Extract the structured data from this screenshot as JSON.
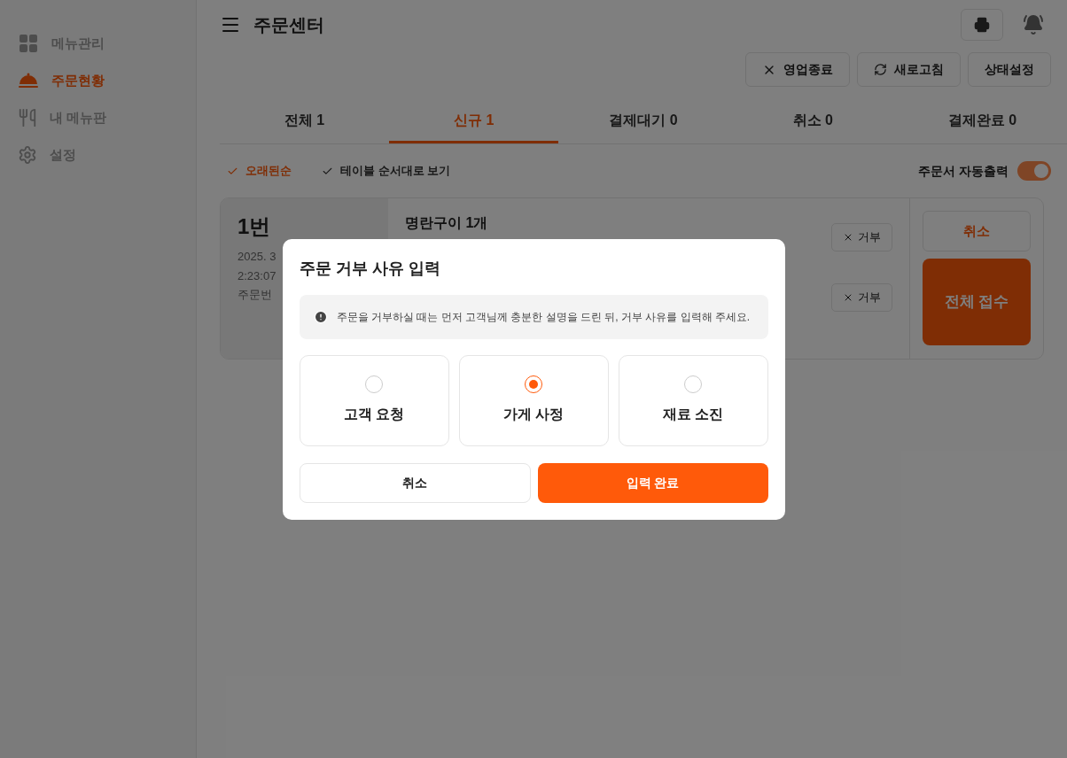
{
  "sidebar": {
    "items": [
      {
        "label": "메뉴관리",
        "selected": false
      },
      {
        "label": "주문현황",
        "selected": true
      },
      {
        "label": "내 메뉴판",
        "selected": false
      },
      {
        "label": "설정",
        "selected": false
      }
    ]
  },
  "header": {
    "title": "주문센터"
  },
  "action_buttons": [
    {
      "label": "영업종료"
    },
    {
      "label": "새로고침"
    },
    {
      "label": "상태설정"
    }
  ],
  "tabs": [
    {
      "label": "전체 1",
      "selected": false
    },
    {
      "label": "신규 1",
      "selected": true
    },
    {
      "label": "결제대기 0",
      "selected": false
    },
    {
      "label": "취소 0",
      "selected": false
    },
    {
      "label": "결제완료 0",
      "selected": false
    }
  ],
  "sort_options": [
    {
      "label": "오래된순",
      "selected": true
    },
    {
      "label": "테이블 순서대로 보기",
      "selected": false
    }
  ],
  "auto_print": {
    "label": "주문서 자동출력",
    "on": true
  },
  "order_card": {
    "number": "1번",
    "date_lines": [
      "2025. 3",
      "2:23:07"
    ],
    "order_no": "주문번",
    "items": [
      {
        "name": "명란구이 1개",
        "reject": "거부"
      },
      {
        "reject": "거부"
      }
    ],
    "cancel": "취소",
    "accept_all": "전체 접수"
  },
  "modal": {
    "title": "주문 거부 사유 입력",
    "notice": "주문을 거부하실 때는 먼저 고객님께 충분한 설명을 드린 뒤, 거부 사유를 입력해 주세요.",
    "options": [
      {
        "label": "고객 요청",
        "selected": false
      },
      {
        "label": "가게 사정",
        "selected": true
      },
      {
        "label": "재료 소진",
        "selected": false
      }
    ],
    "cancel": "취소",
    "confirm": "입력 완료"
  }
}
